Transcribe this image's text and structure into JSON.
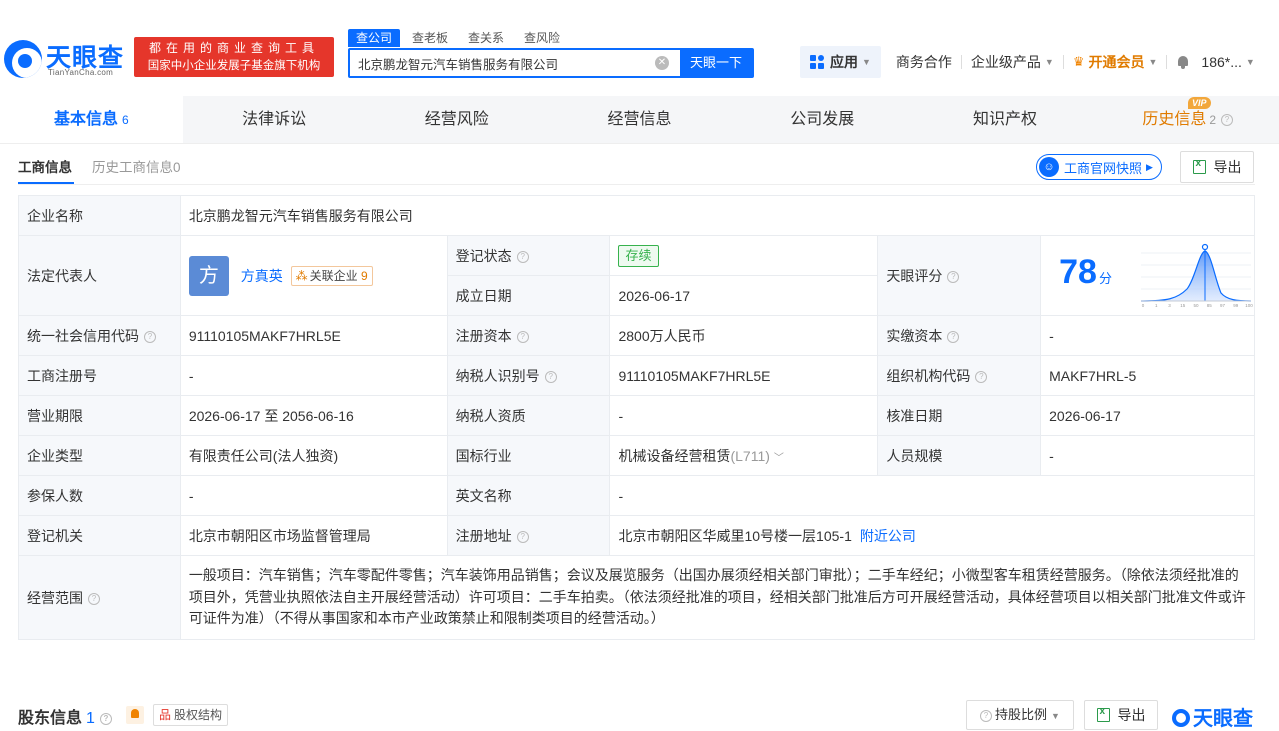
{
  "header": {
    "logo_text": "天眼查",
    "logo_sub": "TianYanCha.com",
    "slogan_line1": "都在用的商业查询工具",
    "slogan_line2": "国家中小企业发展子基金旗下机构",
    "search_tabs": [
      "查公司",
      "查老板",
      "查关系",
      "查风险"
    ],
    "search_value": "北京鹏龙智元汽车销售服务有限公司",
    "search_button": "天眼一下",
    "nav": {
      "apps": "应用",
      "business": "商务合作",
      "enterprise": "企业级产品",
      "vip": "开通会员",
      "user": "186*..."
    }
  },
  "main_tabs": [
    {
      "label": "基本信息",
      "count": "6"
    },
    {
      "label": "法律诉讼"
    },
    {
      "label": "经营风险"
    },
    {
      "label": "经营信息"
    },
    {
      "label": "公司发展"
    },
    {
      "label": "知识产权"
    },
    {
      "label": "历史信息",
      "count": "2"
    }
  ],
  "vip_badge": "VIP",
  "sub_tabs": [
    "工商信息",
    "历史工商信息0"
  ],
  "snapshot_button": "工商官网快照",
  "export_label": "导出",
  "info": {
    "company_name_label": "企业名称",
    "company_name": "北京鹏龙智元汽车销售服务有限公司",
    "legal_rep_label": "法定代表人",
    "legal_rep_avatar": "方",
    "legal_rep_name": "方真英",
    "related_label": "关联企业",
    "related_count": "9",
    "reg_status_label": "登记状态",
    "reg_status": "存续",
    "found_date_label": "成立日期",
    "found_date": "2026-06-17",
    "score_label": "天眼评分",
    "score": "78",
    "score_unit": "分",
    "credit_code_label": "统一社会信用代码",
    "credit_code": "91110105MAKF7HRL5E",
    "reg_capital_label": "注册资本",
    "reg_capital": "2800万人民币",
    "paid_capital_label": "实缴资本",
    "paid_capital": "-",
    "reg_no_label": "工商注册号",
    "reg_no": "-",
    "taxpayer_id_label": "纳税人识别号",
    "taxpayer_id": "91110105MAKF7HRL5E",
    "org_code_label": "组织机构代码",
    "org_code": "MAKF7HRL-5",
    "term_label": "营业期限",
    "term": "2026-06-17 至 2056-06-16",
    "taxpayer_qual_label": "纳税人资质",
    "taxpayer_qual": "-",
    "approve_date_label": "核准日期",
    "approve_date": "2026-06-17",
    "type_label": "企业类型",
    "type": "有限责任公司(法人独资)",
    "industry_label": "国标行业",
    "industry": "机械设备经营租赁",
    "industry_code": "(L711)",
    "staff_label": "人员规模",
    "staff": "-",
    "insured_label": "参保人数",
    "insured": "-",
    "english_name_label": "英文名称",
    "english_name": "-",
    "authority_label": "登记机关",
    "authority": "北京市朝阳区市场监督管理局",
    "address_label": "注册地址",
    "address": "北京市朝阳区华威里10号楼一层105-1",
    "nearby_link": "附近公司",
    "scope_label": "经营范围",
    "scope": "一般项目：汽车销售；汽车零配件零售；汽车装饰用品销售；会议及展览服务（出国办展须经相关部门审批）；二手车经纪；小微型客车租赁经营服务。（除依法须经批准的项目外，凭营业执照依法自主开展经营活动）许可项目：二手车拍卖。（依法须经批准的项目，经相关部门批准后方可开展经营活动，具体经营项目以相关部门批准文件或许可证件为准）（不得从事国家和本市产业政策禁止和限制类项目的经营活动。）"
  },
  "score_chart": {
    "ticks": [
      "0",
      "1",
      "3",
      "15",
      "50",
      "85",
      "97",
      "99",
      "100"
    ]
  },
  "shareholders": {
    "title": "股东信息",
    "count": "1",
    "equity_button": "股权结构",
    "ratio_button": "持股比例",
    "export": "导出",
    "watermark": "天眼查"
  }
}
